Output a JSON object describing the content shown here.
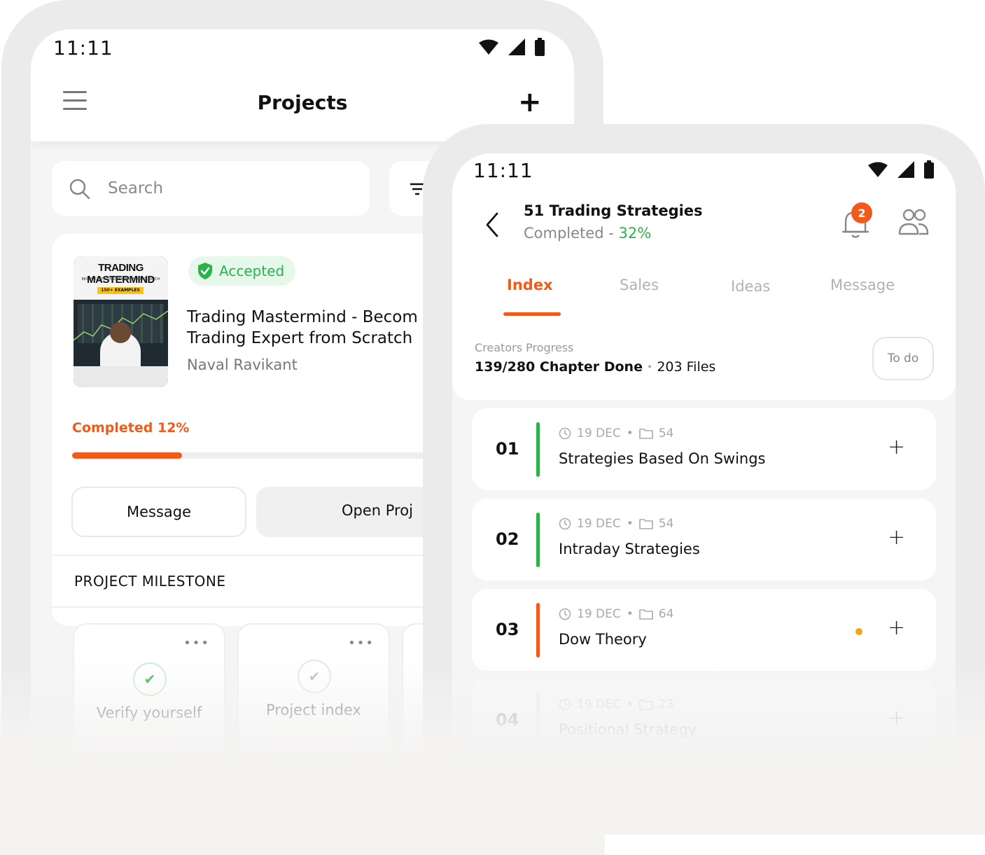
{
  "colors": {
    "accent": "#f25a1a",
    "success": "#2bb34a",
    "warning": "#f7a21b"
  },
  "projects_screen": {
    "status": {
      "time": "11:11"
    },
    "header": {
      "title": "Projects",
      "add_label": "+"
    },
    "search": {
      "placeholder": "Search"
    },
    "project": {
      "cover_title": "TRADING MASTERMIND",
      "cover_subtitle": "BECOME A TRADING EXPERT FROM SCRATCH",
      "cover_tag": "150+ EXAMPLES",
      "badge": "Accepted",
      "title_line1": "Trading Mastermind - Becom",
      "title_line2": "Trading Expert from Scratch",
      "author": "Naval Ravikant",
      "completed_label": "Completed 12%",
      "progress": 0.12,
      "message_button": "Message",
      "open_button": "Open Proj"
    },
    "milestone": {
      "title": "PROJECT MILESTONE",
      "cards": [
        {
          "label": "Verify yourself",
          "done": true
        },
        {
          "label": "Project index",
          "done": false
        }
      ]
    }
  },
  "detail_screen": {
    "status": {
      "time": "11:11"
    },
    "header": {
      "title": "51 Trading Strategies",
      "completed_prefix": "Completed - ",
      "completed_pct": "32%",
      "notifications": "2"
    },
    "tabs": [
      {
        "label": "Index",
        "active": true
      },
      {
        "label": "Sales",
        "active": false
      },
      {
        "label": "Ideas",
        "active": false
      },
      {
        "label": "Message",
        "active": false
      }
    ],
    "creators_progress": {
      "label": "Creators Progress",
      "chapters": "139/280 Chapter Done",
      "files": "203 Files",
      "todo_button": "To do"
    },
    "chapters": [
      {
        "num": "01",
        "date": "19 DEC",
        "files": "54",
        "name": "Strategies Based On Swings",
        "status_color": "#2bb34a",
        "flag": false
      },
      {
        "num": "02",
        "date": "19 DEC",
        "files": "54",
        "name": "Intraday Strategies",
        "status_color": "#2bb34a",
        "flag": false
      },
      {
        "num": "03",
        "date": "19 DEC",
        "files": "64",
        "name": "Dow Theory",
        "status_color": "#f25a1a",
        "flag": true
      },
      {
        "num": "04",
        "date": "19 DEC",
        "files": "23",
        "name": "Positional Strategy",
        "status_color": "#dddddd",
        "flag": false
      }
    ]
  }
}
